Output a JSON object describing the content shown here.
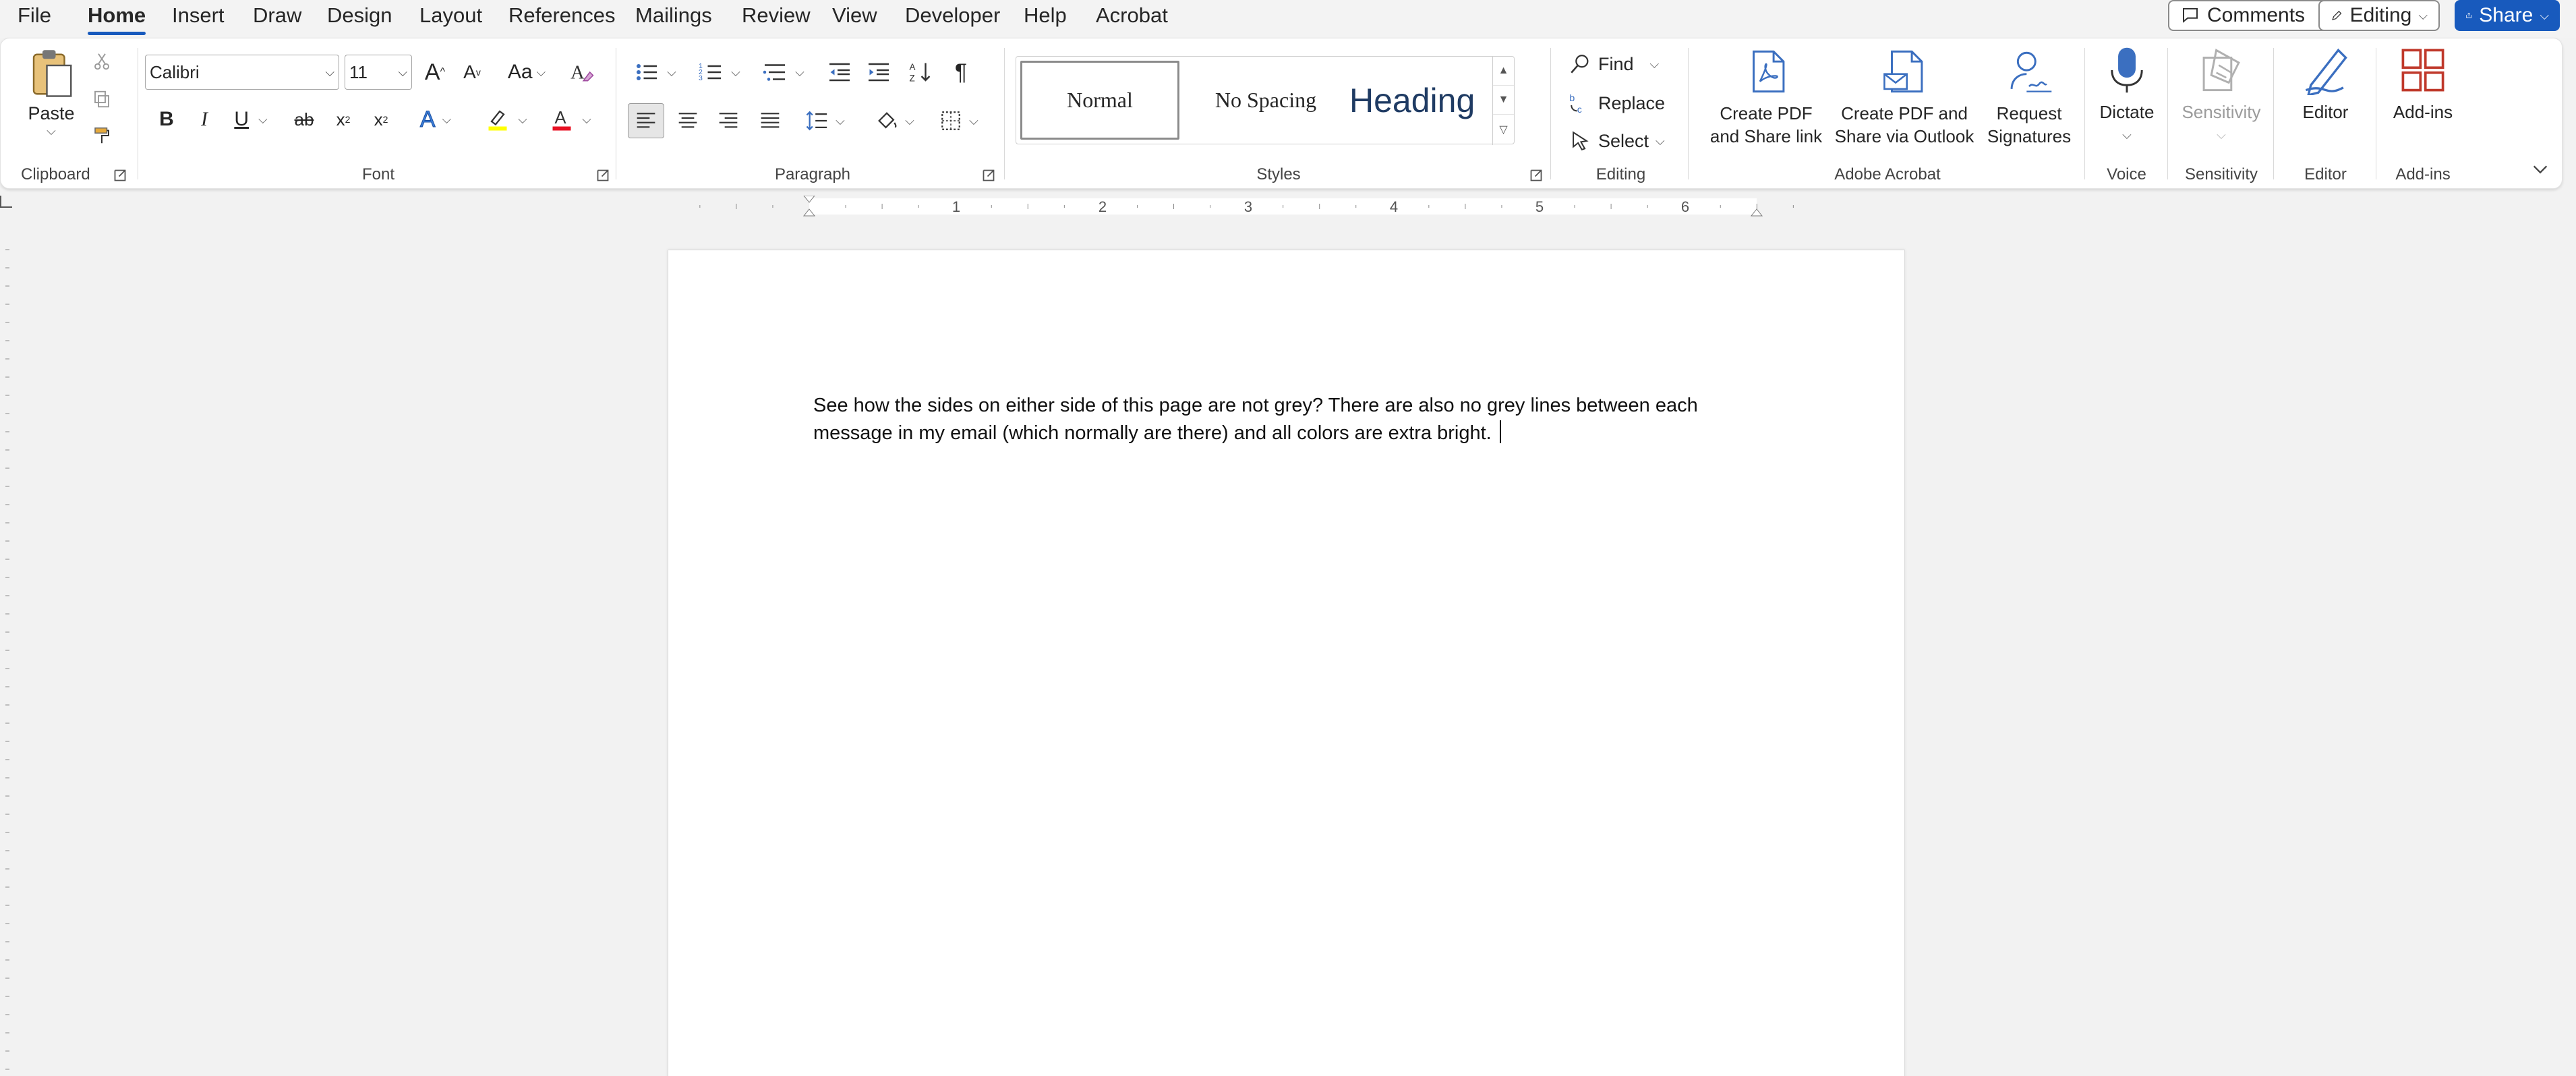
{
  "tabs": [
    {
      "id": "file",
      "label": "File"
    },
    {
      "id": "home",
      "label": "Home"
    },
    {
      "id": "insert",
      "label": "Insert"
    },
    {
      "id": "draw",
      "label": "Draw"
    },
    {
      "id": "design",
      "label": "Design"
    },
    {
      "id": "layout",
      "label": "Layout"
    },
    {
      "id": "references",
      "label": "References"
    },
    {
      "id": "mailings",
      "label": "Mailings"
    },
    {
      "id": "review",
      "label": "Review"
    },
    {
      "id": "view",
      "label": "View"
    },
    {
      "id": "developer",
      "label": "Developer"
    },
    {
      "id": "help",
      "label": "Help"
    },
    {
      "id": "acrobat",
      "label": "Acrobat"
    }
  ],
  "active_tab": "home",
  "topright": {
    "comments": "Comments",
    "editing": "Editing",
    "share": "Share"
  },
  "clipboard": {
    "label": "Clipboard",
    "paste": "Paste"
  },
  "font": {
    "label": "Font",
    "family": "Calibri",
    "size": "11",
    "change_case": "Aa"
  },
  "paragraph": {
    "label": "Paragraph"
  },
  "styles": {
    "label": "Styles",
    "items": [
      "Normal",
      "No Spacing",
      "Heading"
    ]
  },
  "editing": {
    "label": "Editing",
    "find": "Find",
    "replace": "Replace",
    "select": "Select"
  },
  "adobe": {
    "label": "Adobe Acrobat",
    "create_pdf_link": [
      "Create PDF",
      "and Share link"
    ],
    "create_pdf_outlook": [
      "Create PDF and",
      "Share via Outlook"
    ],
    "request_signatures": [
      "Request",
      "Signatures"
    ]
  },
  "voice": {
    "label": "Voice",
    "dictate": "Dictate"
  },
  "sensitivity": {
    "label": "Sensitivity",
    "button": "Sensitivity"
  },
  "editor": {
    "label": "Editor",
    "button": "Editor"
  },
  "addins": {
    "label": "Add-ins",
    "button": "Add-ins"
  },
  "ruler": {
    "numbers": [
      "1",
      "2",
      "3",
      "4",
      "5",
      "6"
    ]
  },
  "document": {
    "lines": [
      "See how the sides on either side of this page are not grey?  There are also no grey lines between each",
      "message in my email (which normally are there) and all colors are extra bright."
    ]
  },
  "colors": {
    "accent": "#185abd",
    "highlight": "#ffff00",
    "font_color": "#e81123"
  }
}
